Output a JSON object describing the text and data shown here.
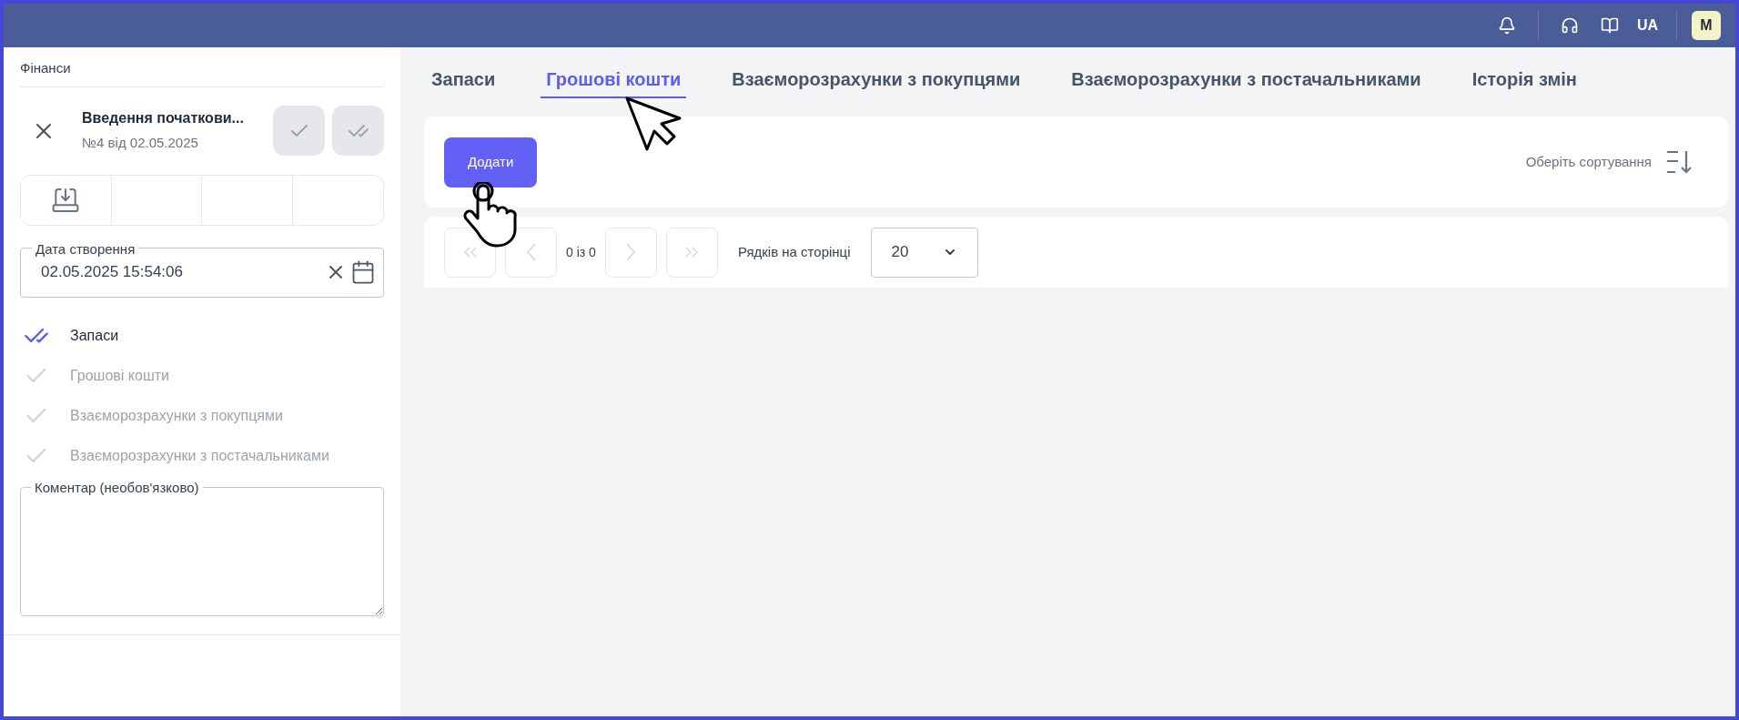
{
  "topbar": {
    "language": "UA",
    "avatar": "M"
  },
  "sidebar": {
    "section": "Фінанси",
    "document": {
      "title": "Введення початкови...",
      "subtitle": "№4 від 02.05.2025"
    },
    "date_field": {
      "label": "Дата створення",
      "value": "02.05.2025 15:54:06"
    },
    "steps": [
      {
        "label": "Запаси",
        "done": true
      },
      {
        "label": "Грошові кошти",
        "done": false
      },
      {
        "label": "Взаєморозрахунки з покупцями",
        "done": false
      },
      {
        "label": "Взаєморозрахунки з постачальниками",
        "done": false
      }
    ],
    "comment": {
      "label": "Коментар (необов'язково)"
    }
  },
  "tabs": [
    {
      "label": "Запаси",
      "selected": false
    },
    {
      "label": "Грошові кошти",
      "selected": true
    },
    {
      "label": "Взаєморозрахунки з покупцями",
      "selected": false
    },
    {
      "label": "Взаєморозрахунки з постачальниками",
      "selected": false
    },
    {
      "label": "Історія змін",
      "selected": false
    }
  ],
  "toolbar": {
    "add_button": "Додати",
    "sort": "Оберіть сортування"
  },
  "pagination": {
    "range": "0 із 0",
    "rows_label": "Рядків на сторінці",
    "rows_value": "20"
  }
}
